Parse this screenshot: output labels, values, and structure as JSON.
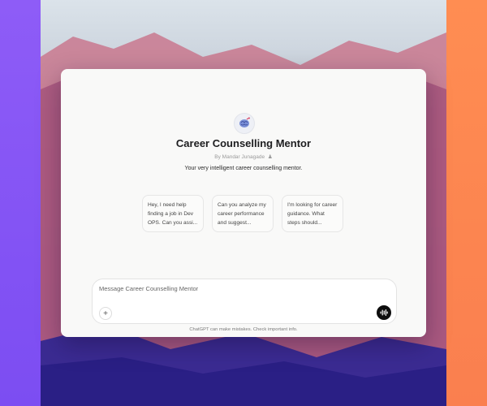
{
  "gpt": {
    "title": "Career Counselling Mentor",
    "author": "By Mandar Junagade",
    "description": "Your very intelligent career counselling mentor.",
    "avatar_icon": "brain-icon"
  },
  "conversation_starters": [
    {
      "text": "Hey, I need help finding a job in Dev OPS. Can you assi..."
    },
    {
      "text": "Can you analyze my career performance and suggest..."
    },
    {
      "text": "I'm looking for career guidance. What steps should..."
    }
  ],
  "composer": {
    "placeholder": "Message Career Counselling Mentor",
    "attach_icon": "plus-icon",
    "voice_icon": "voice-waveform-icon"
  },
  "footer": {
    "disclaimer": "ChatGPT can make mistakes. Check important info."
  },
  "colors": {
    "left_border": "#8e5cf7",
    "right_border": "#ff8d52",
    "window_bg": "#f9f9f8",
    "voice_button": "#0d0d0d"
  }
}
